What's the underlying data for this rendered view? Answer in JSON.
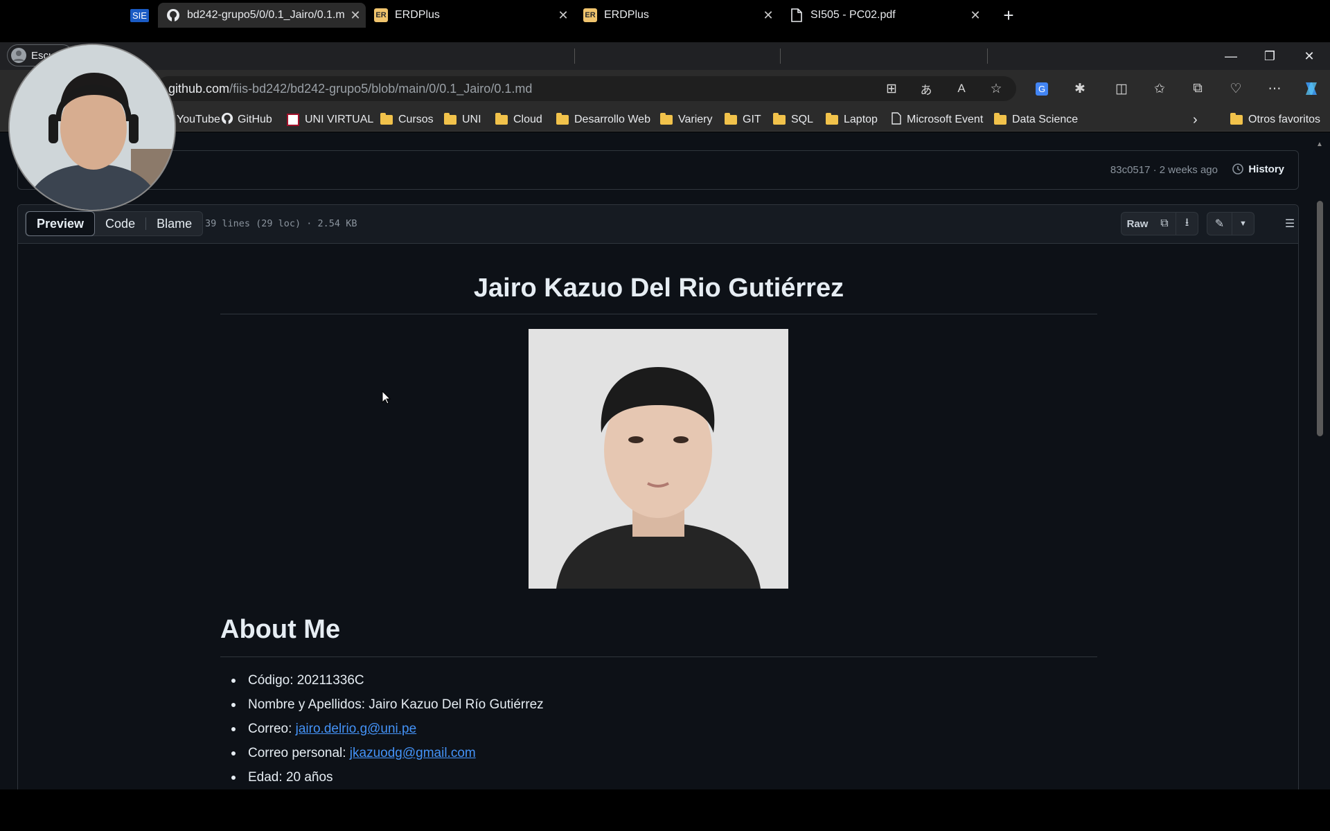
{
  "profile": {
    "label": "Escu"
  },
  "tabs": [
    {
      "label": "SIE",
      "icon": "sie-icon"
    },
    {
      "title": "bd242-grupo5/0/0.1_Jairo/0.1.md",
      "icon": "github-icon",
      "active": true
    },
    {
      "title": "ERDPlus",
      "icon": "erdplus-icon"
    },
    {
      "title": "ERDPlus",
      "icon": "erdplus-icon"
    },
    {
      "title": "SI505 - PC02.pdf",
      "icon": "pdf-document-icon"
    }
  ],
  "address": {
    "host": "github.com",
    "path": "/fiis-bd242/bd242-grupo5/blob/main/0/0.1_Jairo/0.1.md"
  },
  "bookmarks": [
    {
      "label": "YouTube",
      "icon": "youtube-icon"
    },
    {
      "label": "GitHub",
      "icon": "github-icon"
    },
    {
      "label": "UNI VIRTUAL",
      "icon": "uni-virtual-icon"
    },
    {
      "label": "Cursos",
      "icon": "folder-icon"
    },
    {
      "label": "UNI",
      "icon": "folder-icon"
    },
    {
      "label": "Cloud",
      "icon": "folder-icon"
    },
    {
      "label": "Desarrollo Web",
      "icon": "folder-icon"
    },
    {
      "label": "Variery",
      "icon": "folder-icon"
    },
    {
      "label": "GIT",
      "icon": "folder-icon"
    },
    {
      "label": "SQL",
      "icon": "folder-icon"
    },
    {
      "label": "Laptop",
      "icon": "folder-icon"
    },
    {
      "label": "Microsoft Event",
      "icon": "page-icon"
    },
    {
      "label": "Data Science",
      "icon": "folder-icon"
    }
  ],
  "bookmarks_other": "Otros favoritos",
  "commit": {
    "meta": "83c0517 · 2 weeks ago",
    "history_label": "History"
  },
  "file": {
    "views": [
      "Preview",
      "Code",
      "Blame"
    ],
    "active_view": "Preview",
    "info": "39 lines (29 loc) · 2.54 KB",
    "raw_label": "Raw"
  },
  "markdown": {
    "title": "Jairo Kazuo Del Rio Gutiérrez",
    "section_heading": "About Me",
    "items": [
      {
        "label": "Código: ",
        "value": "20211336C"
      },
      {
        "label": "Nombre y Apellidos: ",
        "value": "Jairo Kazuo Del Río Gutiérrez"
      },
      {
        "label": "Correo: ",
        "link": "jairo.delrio.g@uni.pe"
      },
      {
        "label": "Correo personal: ",
        "link": "jkazuodg@gmail.com"
      },
      {
        "label": "Edad: ",
        "value": "20 años"
      }
    ]
  },
  "colors": {
    "page_bg": "#0d1117",
    "link": "#4493f8",
    "border": "#30363d",
    "folder": "#f1c24b"
  }
}
